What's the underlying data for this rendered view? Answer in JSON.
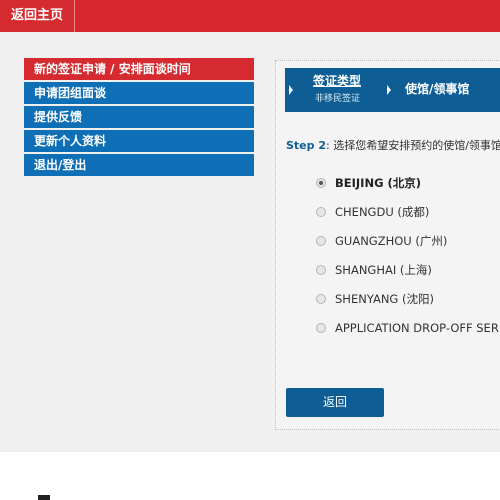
{
  "header": {
    "home_label": "返回主页"
  },
  "sidebar": {
    "items": [
      {
        "label": "新的签证申请 / 安排面谈时间"
      },
      {
        "label": "申请团组面谈"
      },
      {
        "label": "提供反馈"
      },
      {
        "label": "更新个人资料"
      },
      {
        "label": "退出/登出"
      }
    ]
  },
  "steps": {
    "step1_label": "签证类型",
    "step1_sub": "非移民签证",
    "step2_label": "使馆/领事馆"
  },
  "prompt": {
    "step_prefix": "Step 2",
    "text": ": 选择您希望安排预约的使馆/领事馆"
  },
  "posts": {
    "selected": "BEIJING (北京)",
    "options": [
      {
        "label": "BEIJING (北京)"
      },
      {
        "label": "CHENGDU (成都)"
      },
      {
        "label": "GUANGZHOU (广州)"
      },
      {
        "label": "SHANGHAI (上海)"
      },
      {
        "label": "SHENYANG (沈阳)"
      },
      {
        "label": "APPLICATION DROP-OFF SER"
      }
    ]
  },
  "actions": {
    "back_label": "返回"
  },
  "colors": {
    "brand_red": "#d52b30",
    "nav_blue": "#0e6fb6",
    "step_blue": "#0e5e95"
  }
}
